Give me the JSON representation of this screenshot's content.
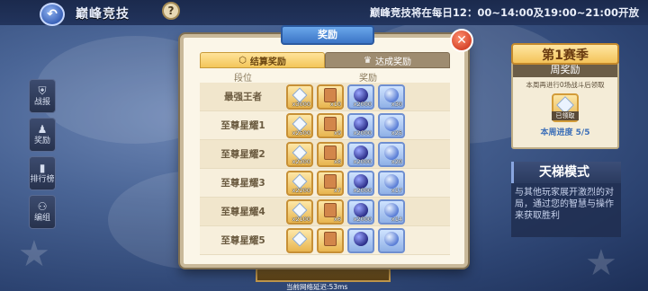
{
  "top": {
    "title": "巅峰竞技",
    "help": "?",
    "schedule": "巅峰竞技将在每日12：00~14:00及19:00~21:00开放"
  },
  "sidemenu": [
    {
      "icon": "shield-icon",
      "glyph": "⛨",
      "label": "战报"
    },
    {
      "icon": "badge-icon",
      "glyph": "♟",
      "label": "奖励"
    },
    {
      "icon": "bar-chart-icon",
      "glyph": "▮",
      "label": "排行榜"
    },
    {
      "icon": "team-icon",
      "glyph": "⚇",
      "label": "编组"
    }
  ],
  "season": {
    "banner": "第1赛季",
    "weekly_title": "周奖励",
    "weekly_desc": "本周再进行0场战斗后领取",
    "claimed": "已领取",
    "progress": "本周进度 5/5"
  },
  "ladder": {
    "title": "天梯模式",
    "desc": "与其他玩家展开激烈的对局，通过您的智慧与操作来获取胜利"
  },
  "modal": {
    "header": "奖励",
    "tabs": [
      {
        "label": "结算奖励",
        "active": true
      },
      {
        "label": "达成奖励",
        "active": false
      }
    ],
    "col_rank": "段位",
    "col_reward": "奖励",
    "rows": [
      {
        "rank": "最强王者",
        "rewards": [
          "x3000",
          "x10",
          "x2000",
          "x30"
        ]
      },
      {
        "rank": "至尊星耀1",
        "rewards": [
          "x2500",
          "x9",
          "x2000",
          "x25"
        ]
      },
      {
        "rank": "至尊星耀2",
        "rewards": [
          "x2300",
          "x8",
          "x2000",
          "x20"
        ]
      },
      {
        "rank": "至尊星耀3",
        "rewards": [
          "x2200",
          "x7",
          "x2000",
          "x17"
        ]
      },
      {
        "rank": "至尊星耀4",
        "rewards": [
          "x2100",
          "x6",
          "x2000",
          "x14"
        ]
      },
      {
        "rank": "至尊星耀5",
        "rewards": [
          "",
          "",
          "",
          ""
        ]
      }
    ]
  },
  "footer": {
    "ping": "当前网络延迟:53ms"
  }
}
